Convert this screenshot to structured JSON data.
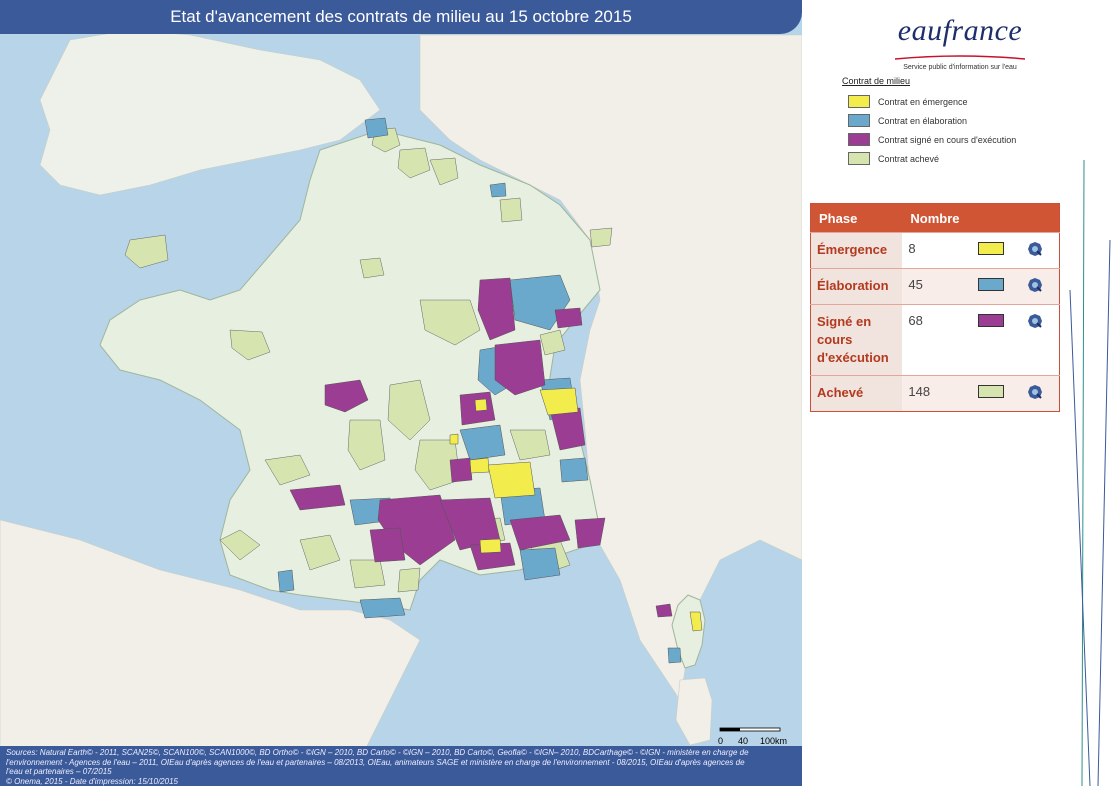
{
  "header": {
    "title": "Etat d'avancement des contrats de milieu au 15 octobre 2015"
  },
  "footer": {
    "sources_lines": [
      "Sources: Natural Earth© - 2011, SCAN25©, SCAN100©, SCAN1000©, BD Ortho© - ©IGN – 2010, BD Carto© - ©IGN – 2010, BD Carto©, Geofla© - ©IGN– 2010, BDCarthage© - ©IGN - ministère en charge de",
      "l'environnement - Agences de l'eau – 2011, OIEau d'après agences de l'eau et partenaires – 08/2013, OIEau, animateurs SAGE et ministère en charge de l'environnement - 08/2015, OIEau d'après agences de",
      "l'eau et partenaires – 07/2015",
      "© Onema, 2015 - Date d'impression: 15/10/2015"
    ]
  },
  "scale": {
    "labels": [
      "0",
      "40",
      "100km"
    ]
  },
  "brand": {
    "name": "eaufrance",
    "tagline": "Service public d'information sur l'eau"
  },
  "legend": {
    "title": "Contrat de milieu",
    "items": [
      {
        "label": "Contrat en émergence",
        "color": "#f3ec4d"
      },
      {
        "label": "Contrat en élaboration",
        "color": "#6aa8cc"
      },
      {
        "label": "Contrat signé en cours d'exécution",
        "color": "#9b3d92"
      },
      {
        "label": "Contrat achevé",
        "color": "#d6e4b0"
      }
    ]
  },
  "table": {
    "headers": [
      "Phase",
      "Nombre"
    ],
    "rows": [
      {
        "phase": "Émergence",
        "count": "8",
        "color": "#f3ec4d"
      },
      {
        "phase": "Élaboration",
        "count": "45",
        "color": "#6aa8cc"
      },
      {
        "phase": "Signé en cours d'exécution",
        "count": "68",
        "color": "#9b3d92"
      },
      {
        "phase": "Achevé",
        "count": "148",
        "color": "#d6e4b0"
      }
    ]
  },
  "colors": {
    "header": "#3b5a9a",
    "sea": "#b8d4e8",
    "land_france": "#e6efe0",
    "land_neighbors": "#f1efe8",
    "table_header": "#cf5535"
  }
}
